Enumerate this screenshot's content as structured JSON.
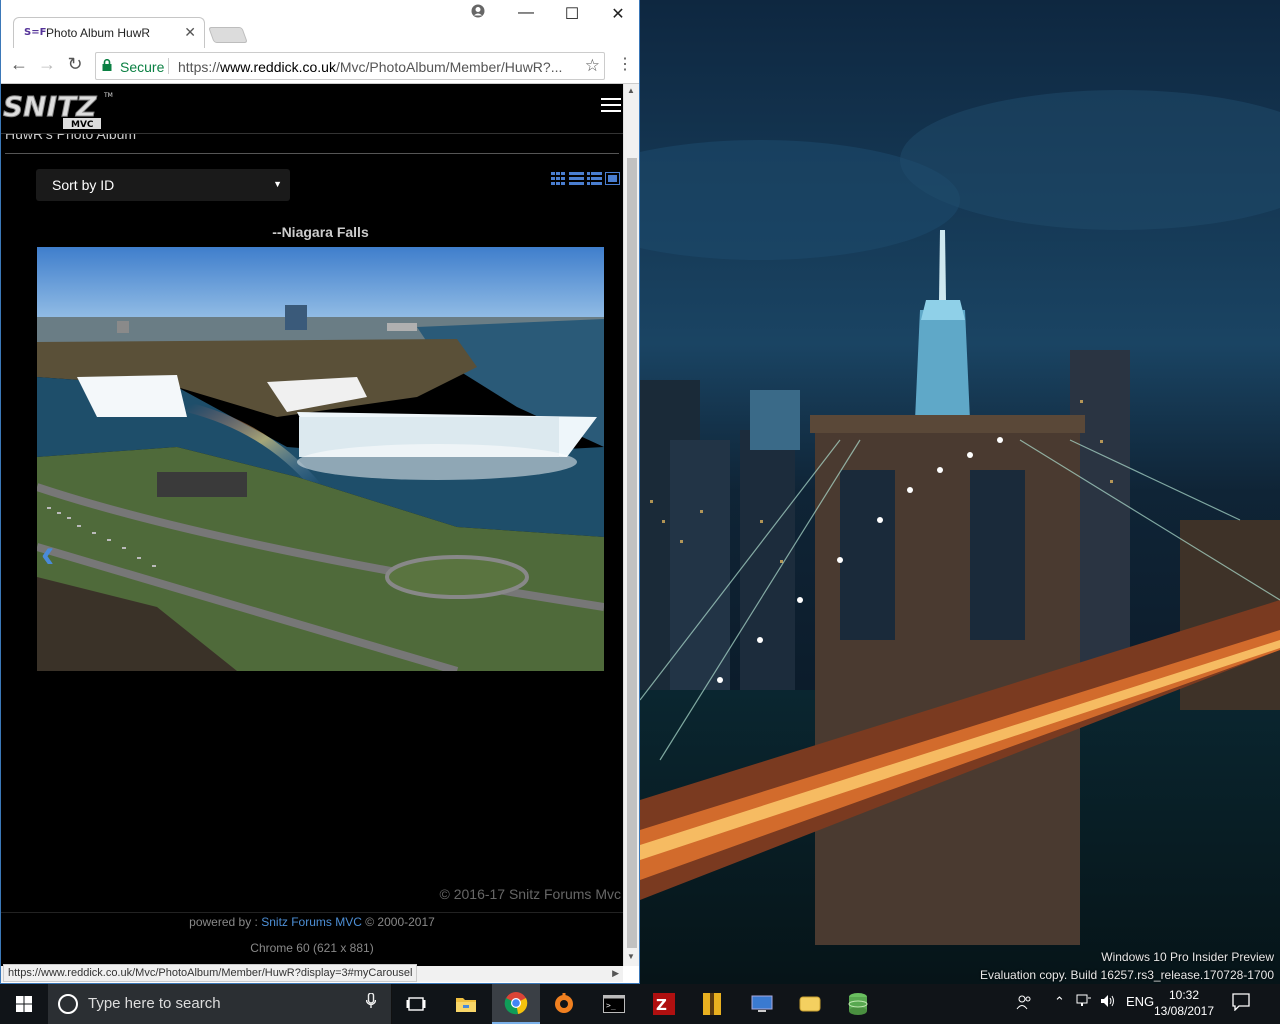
{
  "browser": {
    "tab_favicon": "S=F",
    "tab_title": "Photo Album HuwR",
    "tab_close": "✕",
    "secure_label": "Secure",
    "url_scheme": "https://",
    "url_host": "www.reddick.co.uk",
    "url_path": "/Mvc/PhotoAlbum/Member/HuwR?...",
    "status_url": "https://www.reddick.co.uk/Mvc/PhotoAlbum/Member/HuwR?display=3#myCarousel",
    "window_controls": {
      "minimize": "—",
      "maximize": "☐",
      "close": "✕"
    },
    "nav": {
      "back": "←",
      "forward": "→",
      "reload": "↻",
      "star": "☆",
      "menu": "⋮"
    }
  },
  "page": {
    "logo_text": "SNITZ",
    "logo_sub": "MVC",
    "logo_tm": "TM",
    "album_title": "HuwR's Photo Album",
    "sort": {
      "selected": "Sort by ID",
      "arrow": "▼"
    },
    "photo_title": "--Niagara Falls",
    "carousel_prev": "‹",
    "copyright": "© 2016-17 Snitz Forums Mvc",
    "powered_prefix": "powered by : ",
    "powered_link": "Snitz Forums MVC",
    "powered_suffix": " © 2000-2017",
    "browser_info": "Chrome 60 (621 x 881)"
  },
  "desktop": {
    "watermark_line1": "Windows 10 Pro Insider Preview",
    "watermark_line2": "Evaluation copy. Build 16257.rs3_release.170728-1700"
  },
  "taskbar": {
    "search_placeholder": "Type here to search",
    "language": "ENG",
    "time": "10:32",
    "date": "13/08/2017",
    "icons": [
      "task-view-icon",
      "file-explorer-icon",
      "chrome-icon",
      "avast-icon",
      "terminal-icon",
      "filezilla-icon",
      "winrar-icon",
      "remote-desktop-icon",
      "sticky-icon",
      "database-icon"
    ]
  },
  "colors": {
    "secure_green": "#0b8043",
    "link_blue": "#4d8fd6",
    "taskbar_bg": "#101418",
    "page_bg": "#000000"
  }
}
